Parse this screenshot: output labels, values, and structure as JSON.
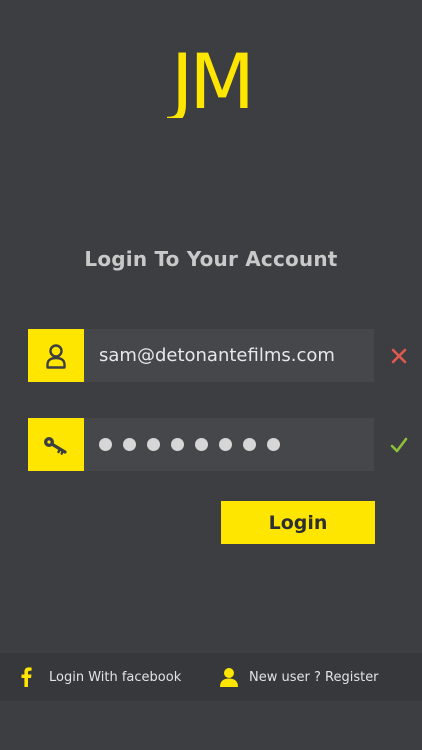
{
  "logo": {
    "text": "JM",
    "color": "#ffe600"
  },
  "login": {
    "title": "Login To Your Account",
    "email": {
      "value": "sam@detonantefilms.com",
      "icon": "user-icon",
      "status_icon": "close-icon",
      "status_color": "#e05a4e"
    },
    "password": {
      "masked_length": 8,
      "icon": "key-icon",
      "status_icon": "check-icon",
      "status_color": "#8fbf3a"
    },
    "button_label": "Login"
  },
  "footer": {
    "facebook_label": "Login With facebook",
    "facebook_icon": "facebook-icon",
    "register_label": "New user ? Register",
    "register_icon": "user-icon"
  },
  "colors": {
    "background": "#3d3e42",
    "accent": "#ffe600",
    "input_bg": "#46474b",
    "footer_bg": "#37383c"
  }
}
